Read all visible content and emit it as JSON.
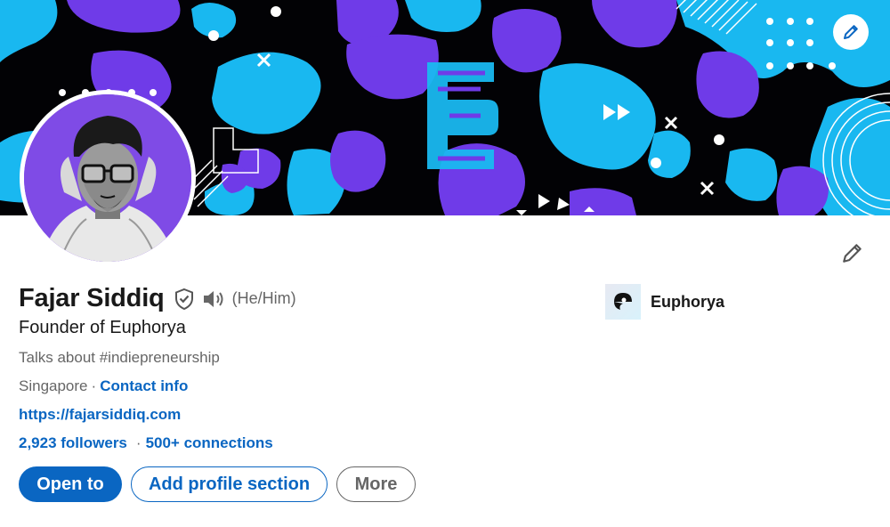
{
  "profile": {
    "name": "Fajar Siddiq",
    "pronouns": "(He/Him)",
    "headline": "Founder of Euphorya",
    "talks_about": "Talks about #indiepreneurship",
    "location": "Singapore",
    "contact_label": "Contact info",
    "website": "https://fajarsiddiq.com",
    "followers": "2,923 followers",
    "connections": "500+ connections",
    "separator": "·"
  },
  "actions": {
    "open_to": "Open to",
    "add_section": "Add profile section",
    "more": "More"
  },
  "company": {
    "name": "Euphorya"
  },
  "icons": {
    "edit_banner": "pencil-icon",
    "edit_profile": "pencil-icon",
    "verified": "shield-check-icon",
    "pronunciation": "speaker-icon",
    "company_logo": "euphorya-logo"
  },
  "colors": {
    "link_blue": "#0a66c2",
    "banner_purple": "#6f3be8",
    "banner_cyan": "#19b8f0",
    "banner_black": "#020205"
  }
}
